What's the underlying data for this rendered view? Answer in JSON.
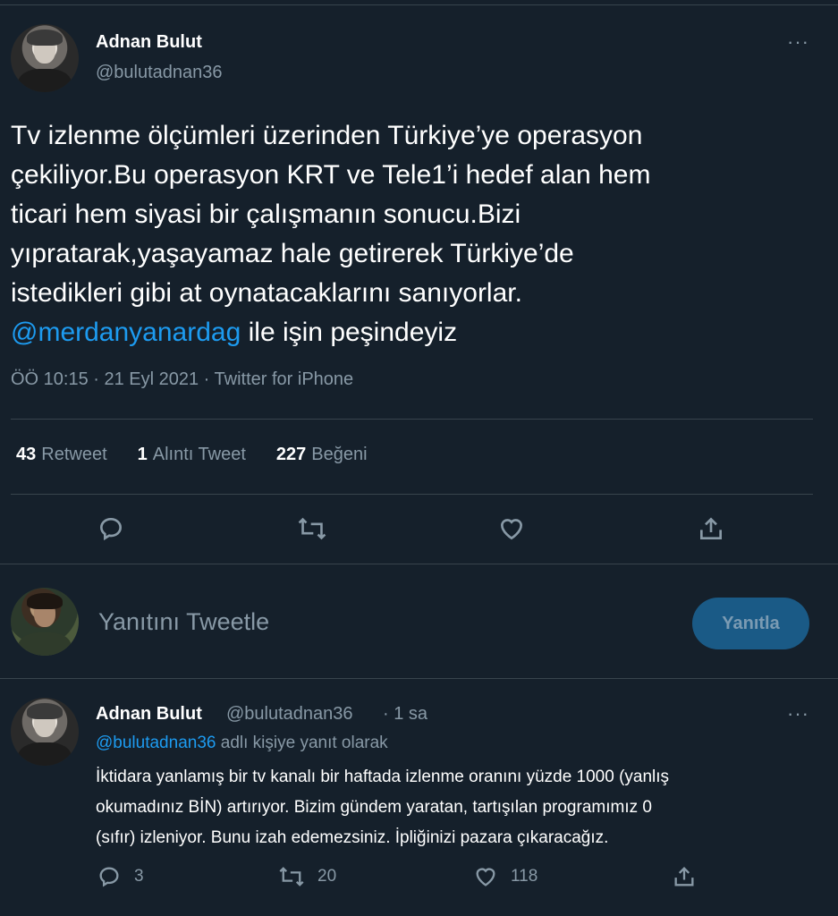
{
  "main_tweet": {
    "author_name": "Adnan Bulut",
    "author_handle": "@bulutadnan36",
    "text_line1": "Tv izlenme ölçümleri üzerinden Türkiye’ye operasyon",
    "text_line2": "çekiliyor.Bu operasyon KRT ve Tele1’i hedef alan hem",
    "text_line3": "ticari hem siyasi bir çalışmanın sonucu.Bizi",
    "text_line4": "yıpratarak,yaşayamaz hale getirerek Türkiye’de",
    "text_line5": "istedikleri gibi at oynatacaklarını sanıyorlar.",
    "mention": "@merdanyanardag",
    "text_line6_rest": " ile işin peşindeyiz",
    "timestamp": "ÖÖ 10:15 · 21 Eyl 2021 · Twitter for iPhone",
    "stats": {
      "retweets_count": "43",
      "retweets_label": "Retweet",
      "quotes_count": "1",
      "quotes_label": "Alıntı Tweet",
      "likes_count": "227",
      "likes_label": "Beğeni"
    },
    "actions": [
      "reply-icon",
      "retweet-icon",
      "like-icon",
      "share-icon"
    ]
  },
  "compose": {
    "placeholder": "Yanıtını Tweetle",
    "reply_button": "Yanıtla"
  },
  "reply_tweet": {
    "author_name": "Adnan Bulut",
    "author_handle": "@bulutadnan36",
    "time": "· 1 sa",
    "replying_to_mention": "@bulutadnan36",
    "replying_to_suffix": " adlı kişiye yanıt olarak",
    "text_line1": "İktidara yanlamış bir tv kanalı bir haftada izlenme oranını yüzde 1000 (yanlış",
    "text_line2": "okumadınız BİN) artırıyor. Bizim gündem yaratan, tartışılan programımız 0",
    "text_line3": "(sıfır) izleniyor. Bunu izah edemezsiniz. İpliğinizi pazara çıkaracağız.",
    "reply_count": "3",
    "retweet_count": "20",
    "like_count": "118"
  },
  "more_icon": "···",
  "colors": {
    "background": "#15202b",
    "text": "#ffffff",
    "secondary": "#8899a6",
    "accent": "#1d9bf0",
    "divider": "#38444d"
  }
}
